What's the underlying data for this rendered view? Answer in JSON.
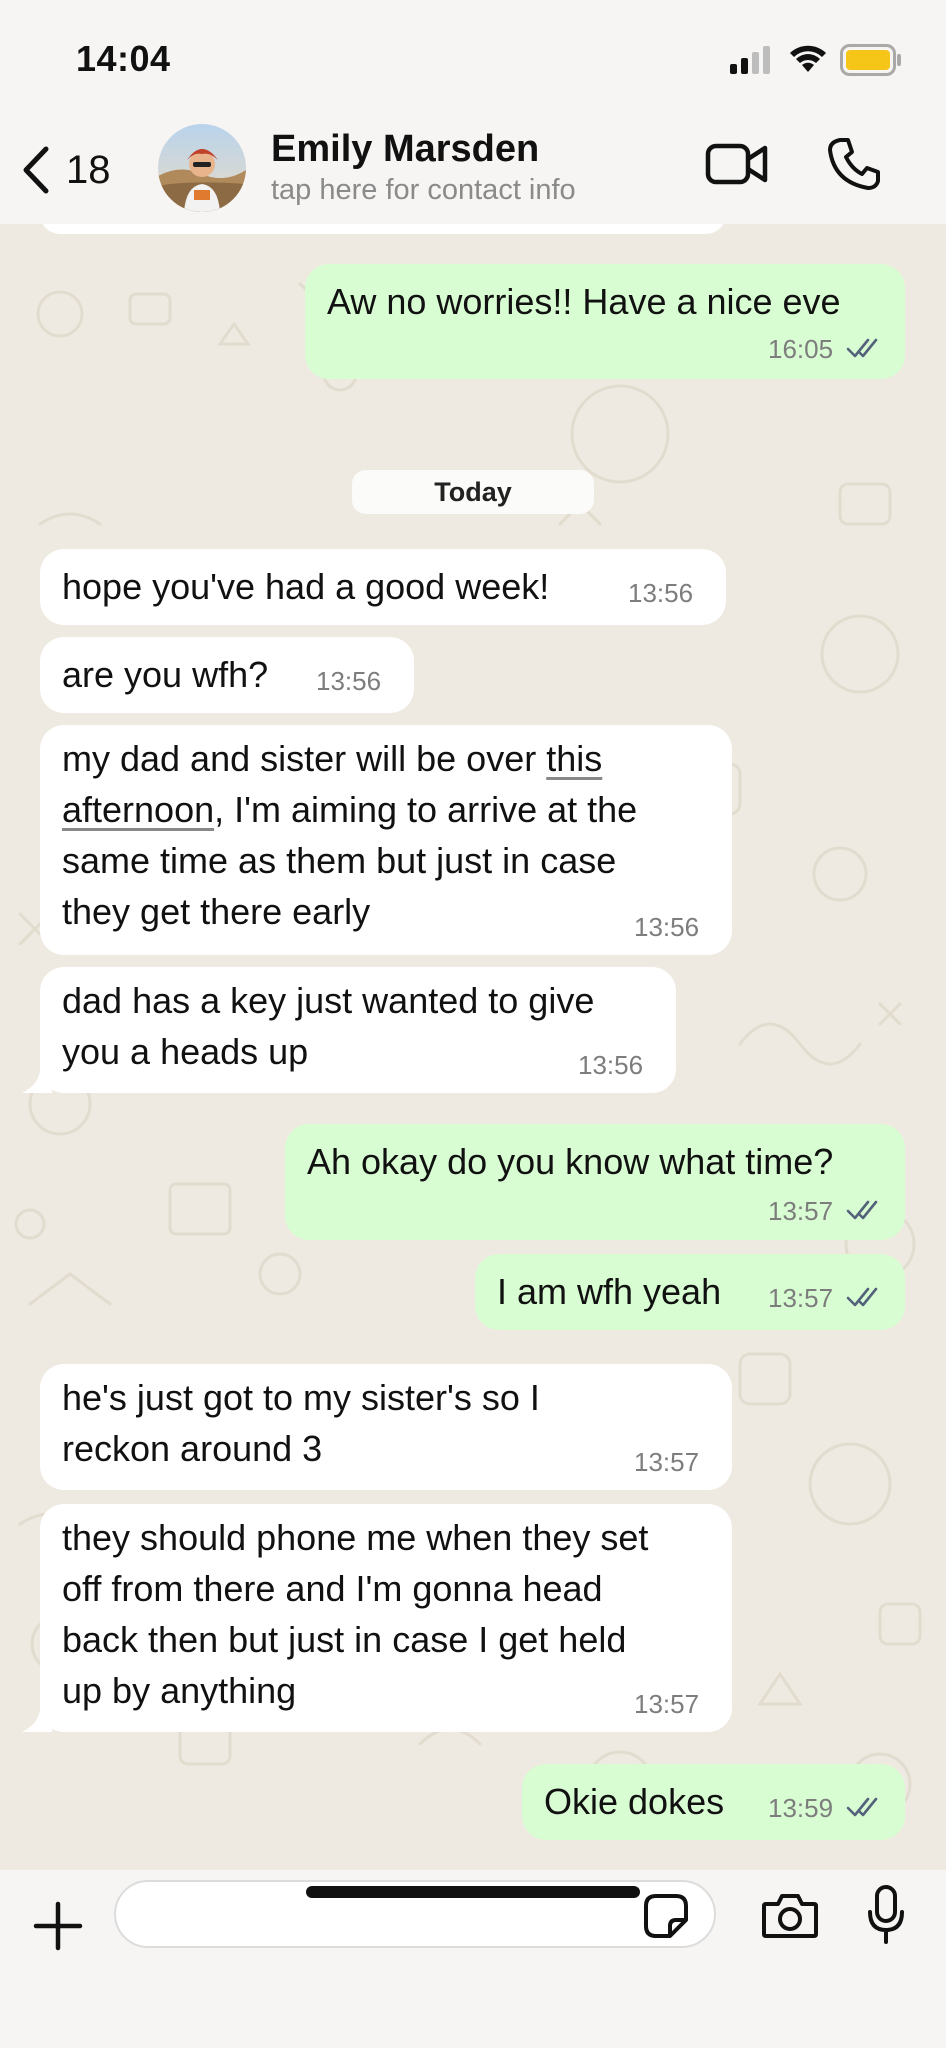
{
  "status": {
    "time": "14:04"
  },
  "header": {
    "back_count": "18",
    "contact_name": "Emily Marsden",
    "contact_subtitle": "tap here for contact info"
  },
  "messages": [
    {
      "dir": "out",
      "text": "Aw no worries!! Have a nice eve",
      "time": "16:05",
      "ticks": "read"
    },
    {
      "dir": "in",
      "text": "hope you've had a good week!",
      "time": "13:56"
    },
    {
      "dir": "in",
      "text": "are you wfh?",
      "time": "13:56"
    },
    {
      "dir": "in",
      "text_lines": [
        "my dad and sister will be over ",
        "this",
        "afternoon",
        ", I'm aiming to arrive at the",
        "same time as them but just in case",
        "they get there early"
      ],
      "time": "13:56"
    },
    {
      "dir": "in",
      "text_lines": [
        "dad has a key just wanted to give",
        "you a heads up"
      ],
      "time": "13:56"
    },
    {
      "dir": "out",
      "text": "Ah okay do you know what time?",
      "time": "13:57",
      "ticks": "read"
    },
    {
      "dir": "out",
      "text": "I am wfh yeah",
      "time": "13:57",
      "ticks": "read"
    },
    {
      "dir": "in",
      "text_lines": [
        "he's just got to my sister's so I",
        "reckon around 3"
      ],
      "time": "13:57"
    },
    {
      "dir": "in",
      "text_lines": [
        "they should phone me when they set",
        "off from there and I'm gonna head",
        "back then but just in case I get held",
        "up by anything"
      ],
      "time": "13:57"
    },
    {
      "dir": "out",
      "text": "Okie dokes",
      "time": "13:59",
      "ticks": "read"
    }
  ],
  "date_divider": "Today",
  "input": {
    "placeholder": ""
  },
  "colors": {
    "outgoing_bubble": "#d9fdd3",
    "incoming_bubble": "#ffffff",
    "read_tick": "#53bdeb"
  }
}
